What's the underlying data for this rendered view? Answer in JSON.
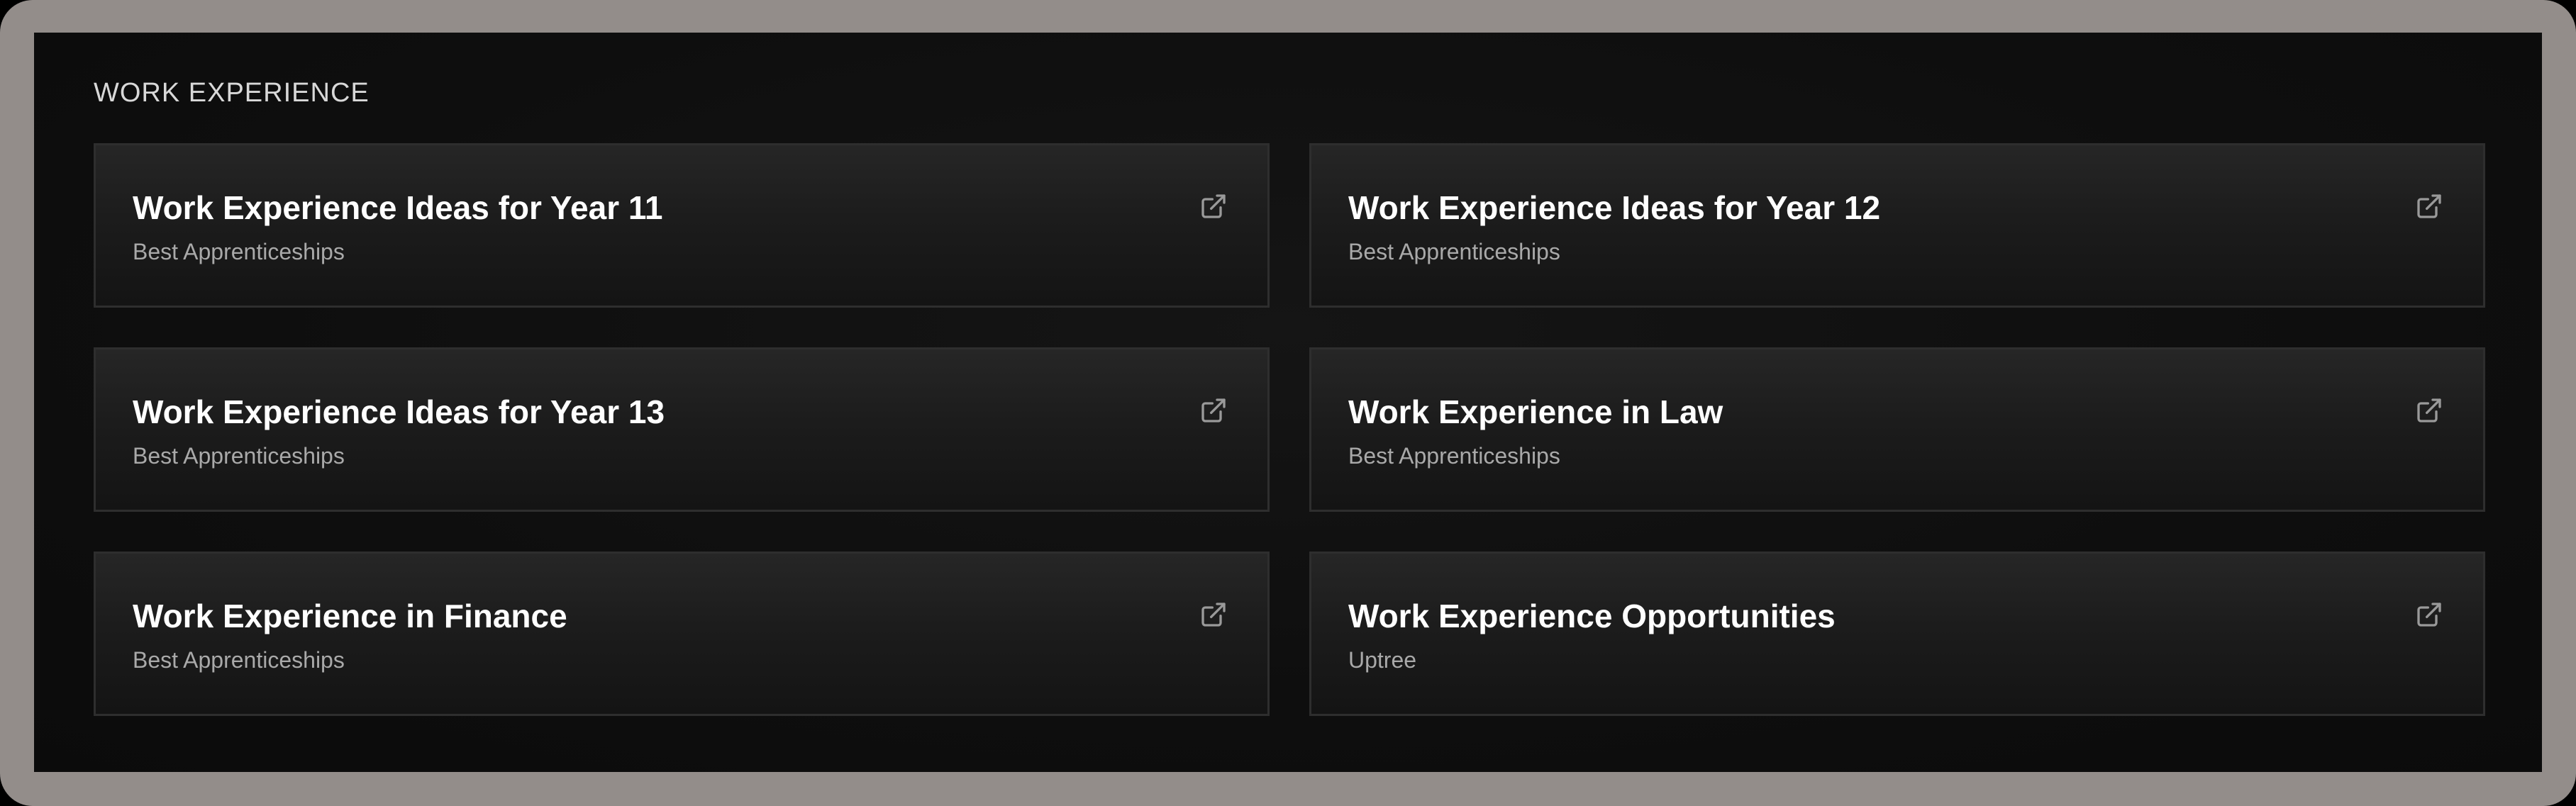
{
  "section": {
    "title": "WORK EXPERIENCE"
  },
  "cards": [
    {
      "title": "Work Experience Ideas for Year 11",
      "source": "Best Apprenticeships",
      "icon": "external-link-icon"
    },
    {
      "title": "Work Experience Ideas for Year 12",
      "source": "Best Apprenticeships",
      "icon": "external-link-icon"
    },
    {
      "title": "Work Experience Ideas for Year 13",
      "source": "Best Apprenticeships",
      "icon": "external-link-icon"
    },
    {
      "title": "Work Experience in Law",
      "source": "Best Apprenticeships",
      "icon": "external-link-icon"
    },
    {
      "title": "Work Experience in Finance",
      "source": "Best Apprenticeships",
      "icon": "external-link-icon"
    },
    {
      "title": "Work Experience Opportunities",
      "source": "Uptree",
      "icon": "external-link-icon"
    }
  ],
  "colors": {
    "frame": "#938d8a",
    "panel": "#0e0e0e",
    "card": "#1c1c1c",
    "title_text": "#ffffff",
    "source_text": "#a9a9a9",
    "icon": "#9a9a9a"
  }
}
